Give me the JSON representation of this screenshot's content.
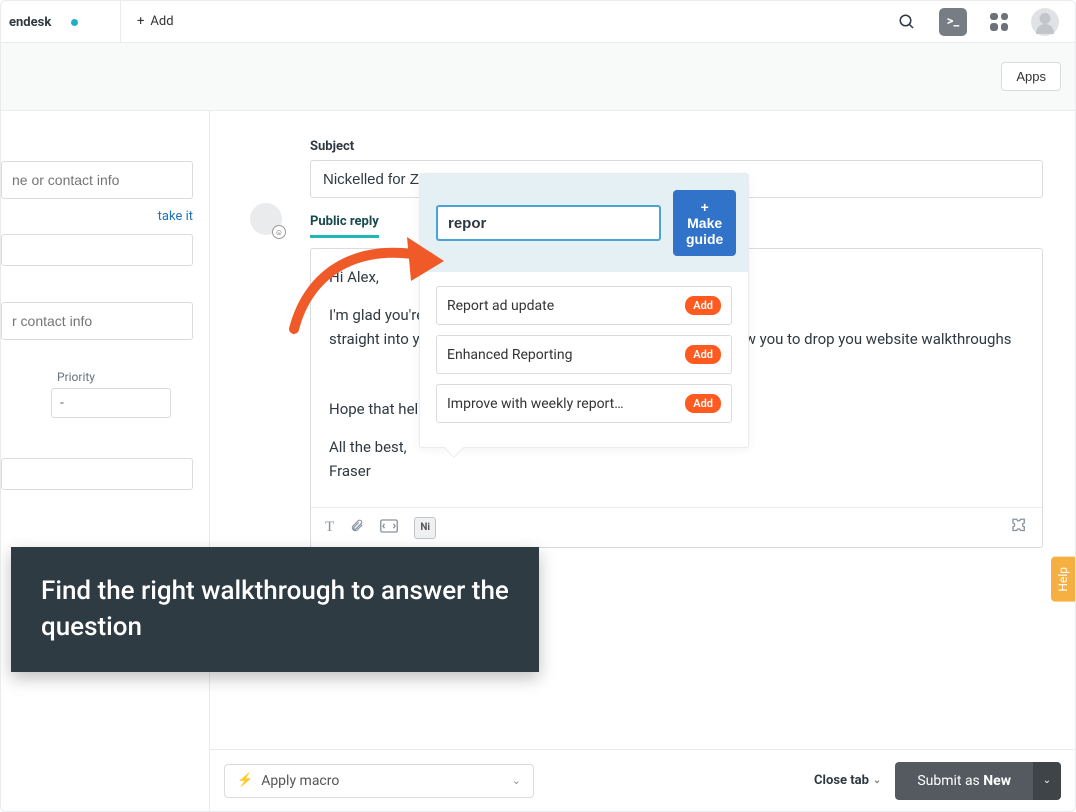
{
  "topbar": {
    "tab_title": "endesk",
    "add_label": "Add"
  },
  "subbar": {
    "apps_label": "Apps"
  },
  "sidebar": {
    "input1_placeholder": "ne or contact info",
    "take_it": "take it",
    "input2_placeholder": "r contact info",
    "priority_label": "Priority",
    "priority_value": "-"
  },
  "ticket": {
    "subject_label": "Subject",
    "subject_value": "Nickelled for Z",
    "reply_tab": "Public reply",
    "body_greeting": "Hi Alex,",
    "body_line1": "I'm glad you're",
    "body_line1b": "straight into y",
    "body_tail": "w you to drop you website walkthroughs",
    "body_hope": "Hope that help",
    "body_signoff1": "All the best,",
    "body_signoff2": "Fraser"
  },
  "guide": {
    "search_value": "repor",
    "make_guide": "+ Make guide",
    "results": [
      {
        "title": "Report ad update",
        "add": "Add"
      },
      {
        "title": "Enhanced Reporting",
        "add": "Add"
      },
      {
        "title": "Improve with weekly report…",
        "add": "Add"
      }
    ]
  },
  "callout": {
    "text": "Find the right walkthrough to answer the question"
  },
  "help": {
    "label": "Help"
  },
  "bottom": {
    "macro": "Apply macro",
    "close_tab": "Close tab",
    "submit_prefix": "Submit as ",
    "submit_status": "New"
  }
}
